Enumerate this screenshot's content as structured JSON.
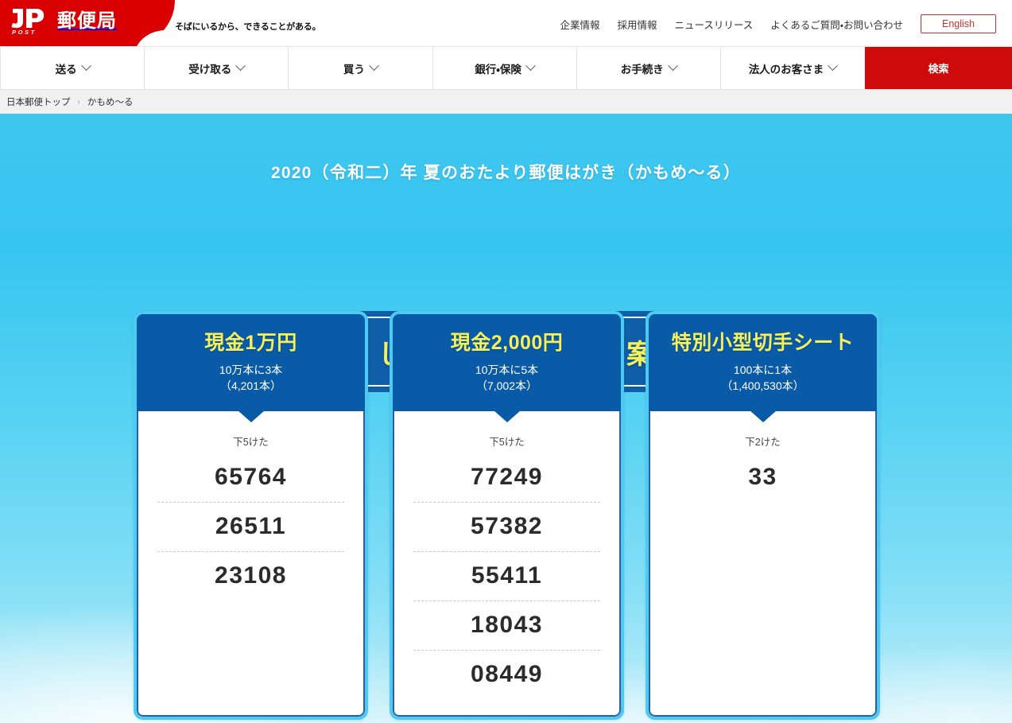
{
  "header": {
    "logo_text": "郵便局",
    "logo_sub": "POST",
    "tagline": "そばにいるから、できることがある。",
    "util_links": [
      {
        "label": "企業情報"
      },
      {
        "label": "採用情報"
      },
      {
        "label": "ニュースリリース"
      },
      {
        "label": "よくあるご質問・お問い合わせ"
      }
    ],
    "english_button": "English"
  },
  "gnav": [
    {
      "label": "送る",
      "has_chevron": true
    },
    {
      "label": "受け取る",
      "has_chevron": true
    },
    {
      "label": "買う",
      "has_chevron": true
    },
    {
      "label": "銀行・保険",
      "has_chevron": true
    },
    {
      "label": "お手続き",
      "has_chevron": true
    },
    {
      "label": "法人のお客さま",
      "has_chevron": true
    },
    {
      "label": "検索",
      "has_chevron": false
    }
  ],
  "breadcrumb": {
    "home": "日本郵便トップ",
    "separator": "›",
    "current": "かもめ〜る"
  },
  "hero": {
    "title": "2020（令和二）年 夏のおたより郵便はがき（かもめ〜る）",
    "ribbon_text": "くじ当せん番号のご案内"
  },
  "cards": [
    {
      "title": "現金1万円",
      "odds": "10万本に3本",
      "count": "（4,201本）",
      "digit_label": "下5けた",
      "numbers": [
        "65764",
        "26511",
        "23108"
      ]
    },
    {
      "title": "現金2,000円",
      "odds": "10万本に5本",
      "count": "（7,002本）",
      "digit_label": "下5けた",
      "numbers": [
        "77249",
        "57382",
        "55411",
        "18043",
        "08449"
      ]
    },
    {
      "title": "特別小型切手シート",
      "odds": "100本に1本",
      "count": "（1,400,530本）",
      "digit_label": "下2けた",
      "numbers": [
        "33"
      ]
    }
  ],
  "colors": {
    "brand_red": "#cf0a0a",
    "ribbon_blue": "#0a5ba7",
    "accent_yellow": "#f6f05b",
    "card_border": "#4ec9f2",
    "sky_top": "#36c5f0",
    "sky_bottom": "#cdf1fa"
  }
}
